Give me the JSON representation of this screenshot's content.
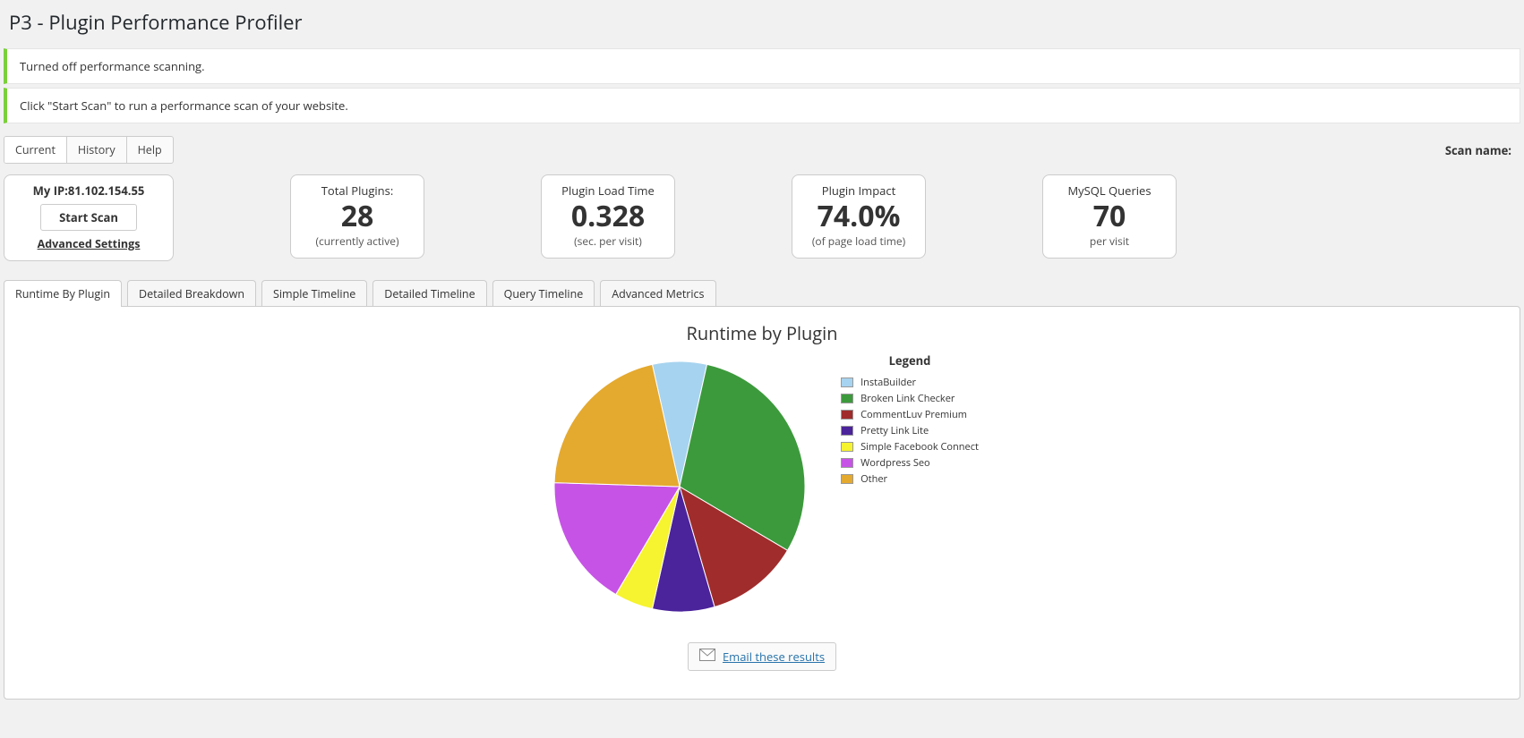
{
  "page_title": "P3 - Plugin Performance Profiler",
  "notices": [
    "Turned off performance scanning.",
    "Click \"Start Scan\" to run a performance scan of your website."
  ],
  "top_tabs": {
    "current": "Current",
    "history": "History",
    "help": "Help"
  },
  "scan_name_label": "Scan name:",
  "scan_card": {
    "ip_label": "My IP:",
    "ip_value": "81.102.154.55",
    "start_scan": "Start Scan",
    "advanced": "Advanced Settings"
  },
  "metrics": {
    "total_plugins": {
      "label": "Total Plugins:",
      "value": "28",
      "sub": "(currently active)"
    },
    "load_time": {
      "label": "Plugin Load Time",
      "value": "0.328",
      "sub": "(sec. per visit)"
    },
    "impact": {
      "label": "Plugin Impact",
      "value": "74.0%",
      "sub": "(of page load time)"
    },
    "queries": {
      "label": "MySQL Queries",
      "value": "70",
      "sub": "per visit"
    }
  },
  "result_tabs": {
    "runtime": "Runtime By Plugin",
    "breakdown": "Detailed Breakdown",
    "simple_timeline": "Simple Timeline",
    "detailed_timeline": "Detailed Timeline",
    "query_timeline": "Query Timeline",
    "advanced_metrics": "Advanced Metrics"
  },
  "chart_title": "Runtime by Plugin",
  "legend_title": "Legend",
  "email_link": "Email these results",
  "chart_data": {
    "type": "pie",
    "title": "Runtime by Plugin",
    "series": [
      {
        "name": "InstaBuilder",
        "value": 7,
        "color": "#a6d3ef"
      },
      {
        "name": "Broken Link Checker",
        "value": 30,
        "color": "#3c9a3c"
      },
      {
        "name": "CommentLuv Premium",
        "value": 12,
        "color": "#a02c2c"
      },
      {
        "name": "Pretty Link Lite",
        "value": 8,
        "color": "#4b239b"
      },
      {
        "name": "Simple Facebook Connect",
        "value": 5,
        "color": "#f6f330"
      },
      {
        "name": "Wordpress Seo",
        "value": 17,
        "color": "#c653e6"
      },
      {
        "name": "Other",
        "value": 21,
        "color": "#e4a92f"
      }
    ]
  }
}
